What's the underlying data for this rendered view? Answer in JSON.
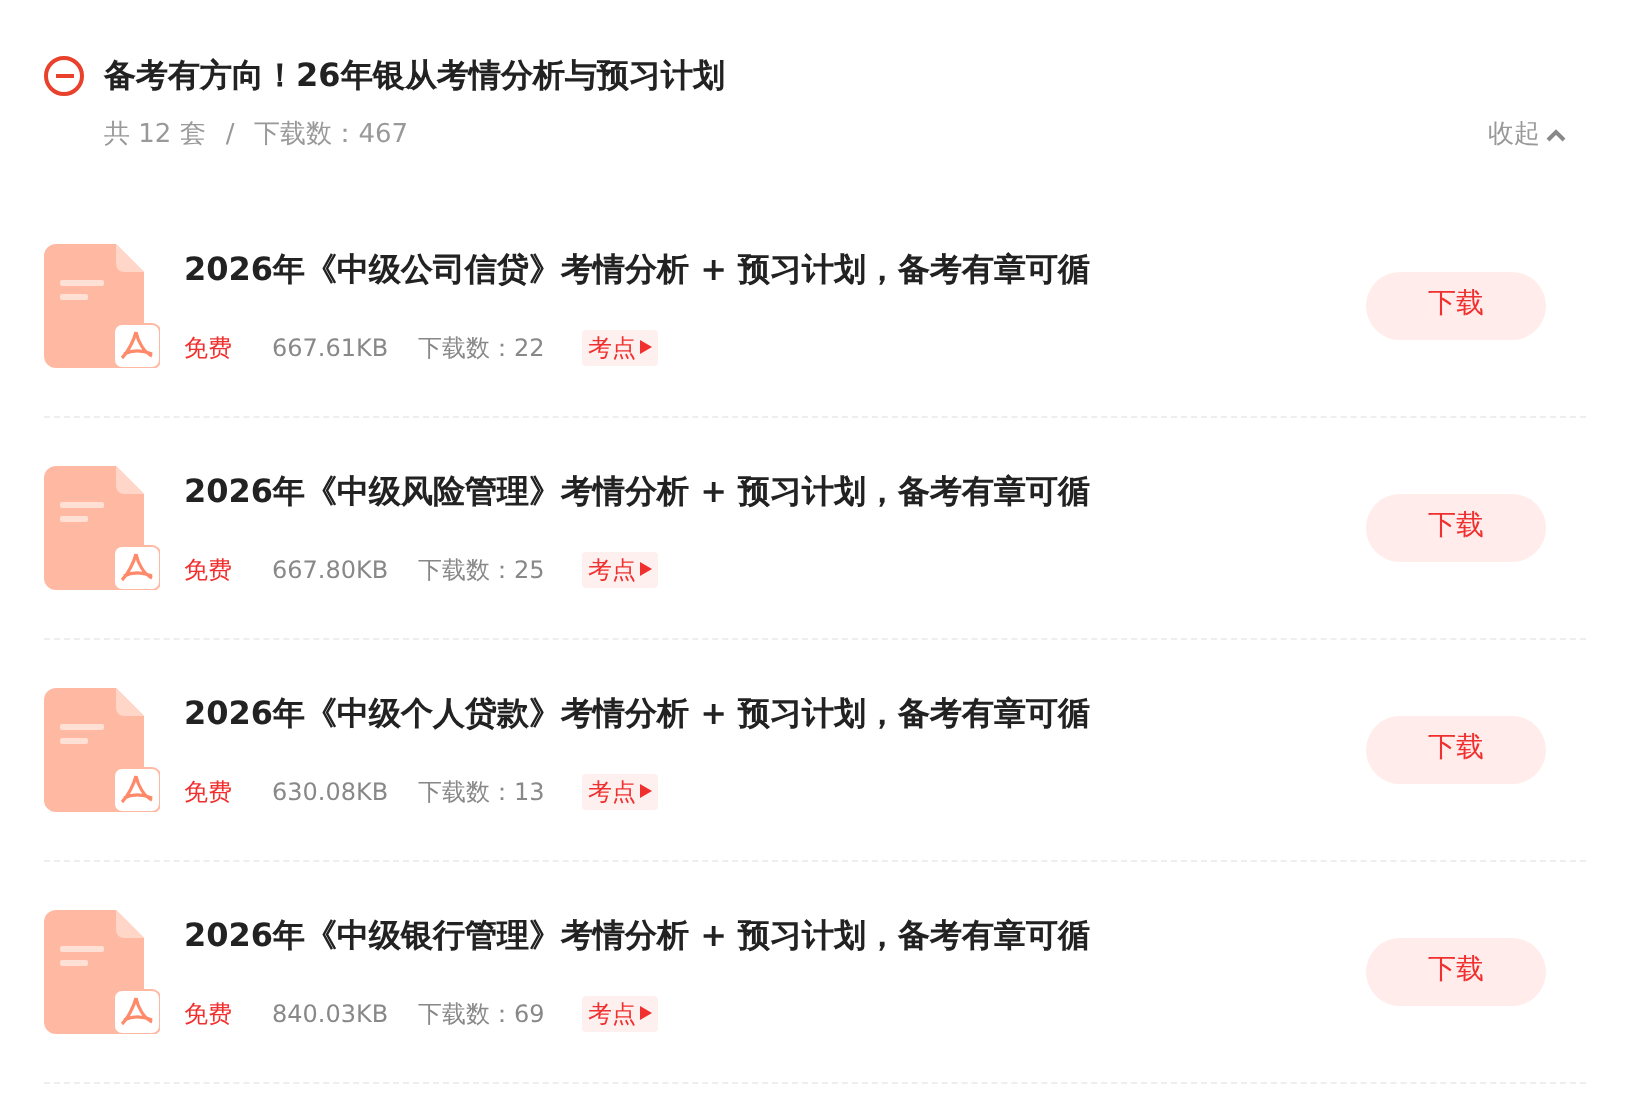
{
  "header": {
    "expanded": true,
    "title": "备考有方向！26年银从考情分析与预习计划",
    "count": "共 12 套",
    "separator": "/",
    "downloads": "下载数：467",
    "toggle": "收起"
  },
  "items": [
    {
      "title": "2026年《中级公司信贷》考情分析 + 预习计划，备考有章可循",
      "price": "免费",
      "size": "667.61KB",
      "downloads": "下载数：22",
      "tag": "考点",
      "button": "下载"
    },
    {
      "title": "2026年《中级风险管理》考情分析 + 预习计划，备考有章可循",
      "price": "免费",
      "size": "667.80KB",
      "downloads": "下载数：25",
      "tag": "考点",
      "button": "下载"
    },
    {
      "title": "2026年《中级个人贷款》考情分析 + 预习计划，备考有章可循",
      "price": "免费",
      "size": "630.08KB",
      "downloads": "下载数：13",
      "tag": "考点",
      "button": "下载"
    },
    {
      "title": "2026年《中级银行管理》考情分析 + 预习计划，备考有章可循",
      "price": "免费",
      "size": "840.03KB",
      "downloads": "下载数：69",
      "tag": "考点",
      "button": "下载"
    }
  ]
}
